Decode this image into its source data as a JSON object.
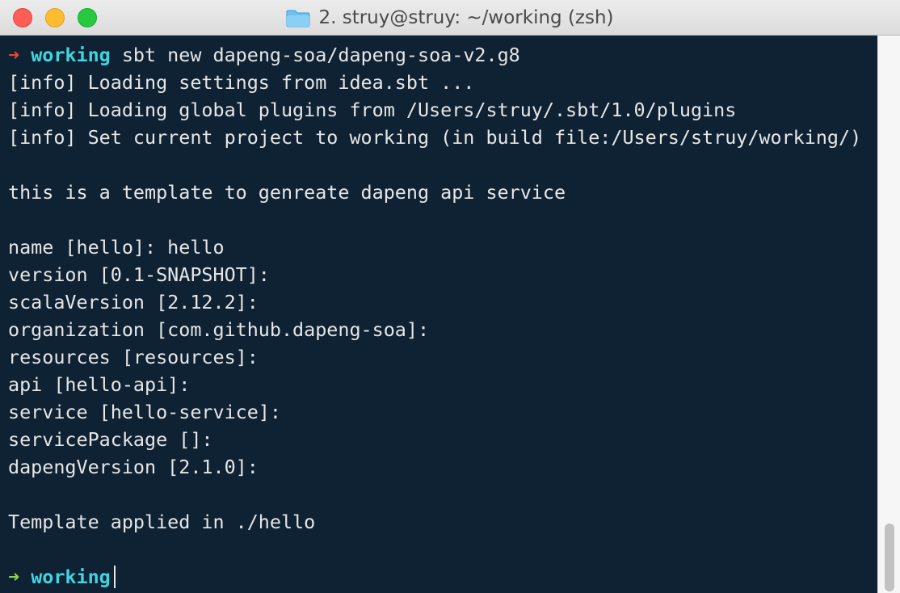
{
  "window": {
    "title": "2. struy@struy: ~/working (zsh)",
    "icon": "folder-icon"
  },
  "colors": {
    "background": "#0f2233",
    "text": "#e6e6e6",
    "prompt_arrow_error": "#e8452f",
    "prompt_arrow_ok": "#8fd14f",
    "directory": "#3fd4e0"
  },
  "terminal": {
    "command_prompt": {
      "arrow": "➜",
      "dir": "working",
      "command": " sbt new dapeng-soa/dapeng-soa-v2.g8"
    },
    "output": [
      "[info] Loading settings from idea.sbt ...",
      "[info] Loading global plugins from /Users/struy/.sbt/1.0/plugins",
      "[info] Set current project to working (in build file:/Users/struy/working/)",
      "",
      "this is a template to genreate dapeng api service",
      "",
      "name [hello]: hello",
      "version [0.1-SNAPSHOT]:",
      "scalaVersion [2.12.2]:",
      "organization [com.github.dapeng-soa]:",
      "resources [resources]:",
      "api [hello-api]:",
      "service [hello-service]:",
      "servicePackage []:",
      "dapengVersion [2.1.0]:",
      "",
      "Template applied in ./hello",
      ""
    ],
    "final_prompt": {
      "arrow": "➜",
      "dir": "working"
    }
  }
}
